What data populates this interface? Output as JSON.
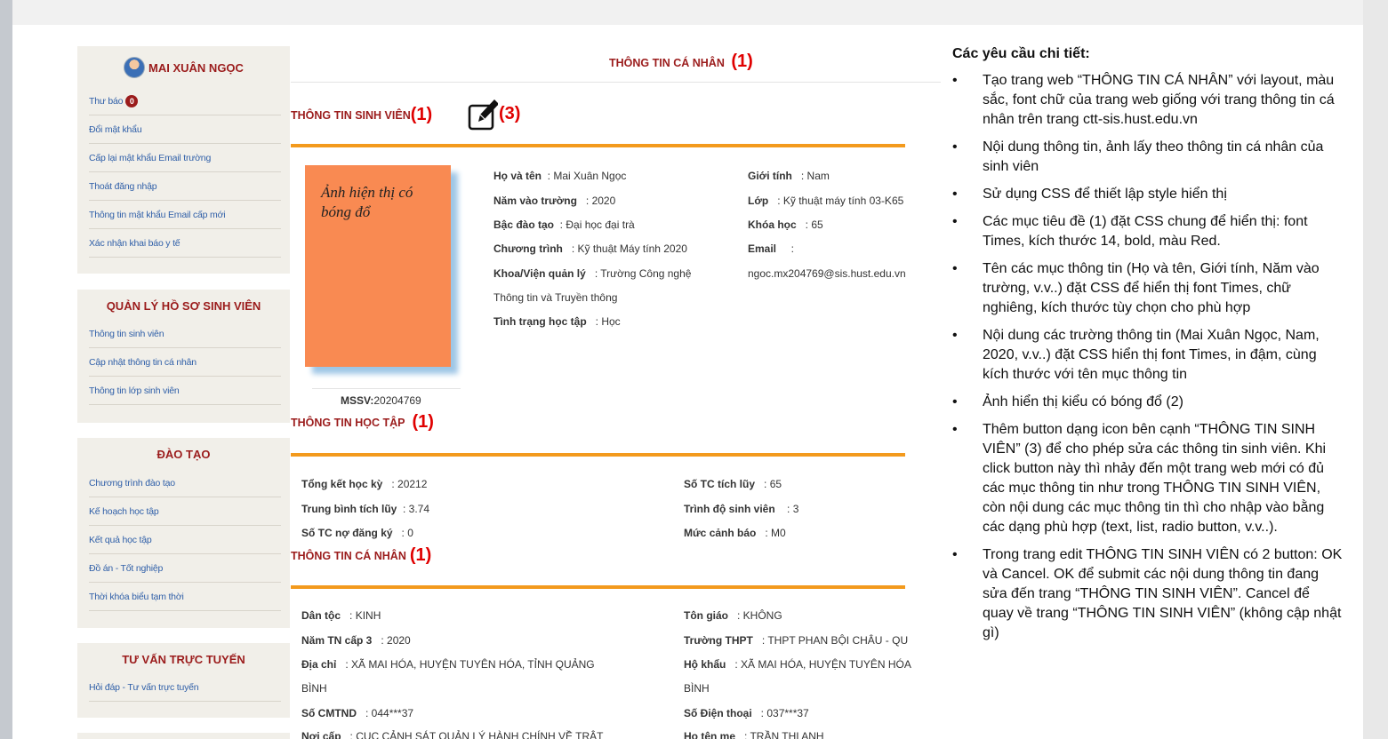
{
  "user": {
    "name": "MAI XUÂN NGỌC"
  },
  "sidebar": {
    "account_items": [
      "Thư báo",
      "Đổi mật khẩu",
      "Cấp lại mật khẩu Email trường",
      "Thoát đăng nhập",
      "Thông tin mật khẩu Email cấp mới",
      "Xác nhận khai báo y tế"
    ],
    "badge": "0",
    "profile_title": "QUẢN LÝ HỒ SƠ SINH VIÊN",
    "profile_items": [
      "Thông tin sinh viên",
      "Cập nhật thông tin cá nhân",
      "Thông tin lớp sinh viên"
    ],
    "training_title": "ĐÀO TẠO",
    "training_items": [
      "Chương trình đào tạo",
      "Kế hoạch học tập",
      "Kết quả học tập",
      "Đồ án - Tốt nghiệp",
      "Thời khóa biểu tạm thời"
    ],
    "consult_title": "TƯ VẤN TRỰC TUYẾN",
    "consult_items": [
      "Hỏi đáp - Tư vấn trực tuyến"
    ]
  },
  "main": {
    "page_title": "THÔNG TIN CÁ NHÂN",
    "num1": "(1)",
    "num2": "(1)",
    "num3": "(3)",
    "num4": "(1)",
    "num5": "(1)",
    "student_section": "THÔNG TIN SINH VIÊN",
    "study_section": "THÔNG TIN HỌC TẬP",
    "personal_section": "THÔNG TIN CÁ NHÂN",
    "photo_caption": "Ảnh hiện thị có bóng đổ",
    "mssv_label": "MSSV:",
    "mssv_value": "20204769",
    "student": {
      "hoten_label": "Họ và tên",
      "hoten": "Mai Xuân Ngọc",
      "namvao_label": "Năm vào trường",
      "namvao": "2020",
      "bac_label": "Bậc đào tạo",
      "bac": "Đại học đại trà",
      "ct_label": "Chương trình",
      "ct": "Kỹ thuật Máy tính 2020",
      "khoa_label": "Khoa/Viện quản lý",
      "khoa": "Trường Công nghệ",
      "khoa2": "Thông tin và Truyền thông",
      "tt_label": "Tình trạng học tập",
      "tt": "Học",
      "gt_label": "Giới tính",
      "gt": "Nam",
      "lop_label": "Lớp",
      "lop": "Kỹ thuật máy tính 03-K65",
      "khoahoc_label": "Khóa học",
      "khoahoc": "65",
      "email_label": "Email",
      "email": "ngoc.mx204769@sis.hust.edu.vn"
    },
    "study": {
      "tkhk_label": "Tổng kết học kỳ",
      "tkhk": "20212",
      "tbtl_label": "Trung bình tích lũy",
      "tbtl": "3.74",
      "tcno_label": "Số TC nợ đăng ký",
      "tcno": "0",
      "tctl_label": "Số TC tích lũy",
      "tctl": "65",
      "tdsv_label": "Trình độ sinh viên",
      "tdsv": "3",
      "mcb_label": "Mức cảnh báo",
      "mcb": "M0"
    },
    "personal": {
      "dantoc_label": "Dân tộc",
      "dantoc": "KINH",
      "namtn_label": "Năm TN cấp 3",
      "namtn": "2020",
      "diachi_label": "Địa chỉ",
      "diachi": "XÃ MAI HÓA, HUYỆN TUYÊN HÓA, TỈNH QUẢNG",
      "diachi2": "BÌNH",
      "cmtnd_label": "Số CMTND",
      "cmtnd": "044***37",
      "noicap_label": "Nơi cấp",
      "noicap": "CỤC CẢNH SÁT QUẢN LÝ HÀNH CHÍNH VỀ TRẬT",
      "tongiao_label": "Tôn giáo",
      "tongiao": "KHÔNG",
      "thpt_label": "Trường THPT",
      "thpt": "THPT PHAN BỘI CHÂU - QU",
      "hokhau_label": "Hộ khẩu",
      "hokhau": "XÃ MAI HÓA, HUYỆN TUYÊN HÓA",
      "hokhau2": "BÌNH",
      "sdt_label": "Số Điện thoại",
      "sdt": "037***37",
      "me_label": "Họ tên mẹ",
      "me": "TRẦN THỊ ANH"
    }
  },
  "requirements": {
    "title": "Các yêu cầu chi tiết:",
    "items": [
      "Tạo trang web “THÔNG TIN CÁ NHÂN” với layout, màu sắc, font chữ của trang web giống với trang thông tin cá nhân trên trang ctt-sis.hust.edu.vn",
      "Nội dung thông tin, ảnh lấy theo thông tin cá nhân của sinh viên",
      "Sử dụng CSS để thiết lập style hiển thị",
      "Các mục tiêu đề (1) đặt CSS chung để hiển thị: font Times, kích thước 14, bold, màu Red.",
      "Tên các mục thông tin (Họ và tên, Giới tính, Năm vào trường, v.v..) đặt CSS để hiển thị font Times, chữ nghiêng, kích thước tùy chọn cho phù hợp",
      "Nội dung các trường thông tin (Mai Xuân Ngọc, Nam, 2020, v.v..) đặt CSS hiển thị font Times, in đậm, cùng kích thước với tên mục thông tin",
      "Ảnh hiển thị kiểu có bóng đổ (2)",
      "Thêm button dạng icon bên cạnh “THÔNG TIN SINH VIÊN” (3) để cho phép sửa các thông tin sinh viên. Khi click button này thì nhảy đến một trang web mới có đủ các mục thông tin như trong THÔNG TIN SINH VIÊN, còn nội dung các mục thông tin thì cho nhập vào bằng các dạng phù hợp (text, list, radio button, v.v..).",
      "Trong trang edit THÔNG TIN SINH VIÊN có 2 button: OK và Cancel. OK để submit các nội dung thông tin đang sửa đến trang “THÔNG TIN SINH VIÊN”. Cancel để quay về trang “THÔNG TIN SINH VIÊN” (không cập nhật gì)"
    ]
  },
  "colors": {
    "title_red": "#9b1c1c",
    "annotation_red": "#e00000",
    "rule_orange": "#f39a1d",
    "photo_orange": "#f98a52",
    "link_blue": "#2f5fa8"
  }
}
